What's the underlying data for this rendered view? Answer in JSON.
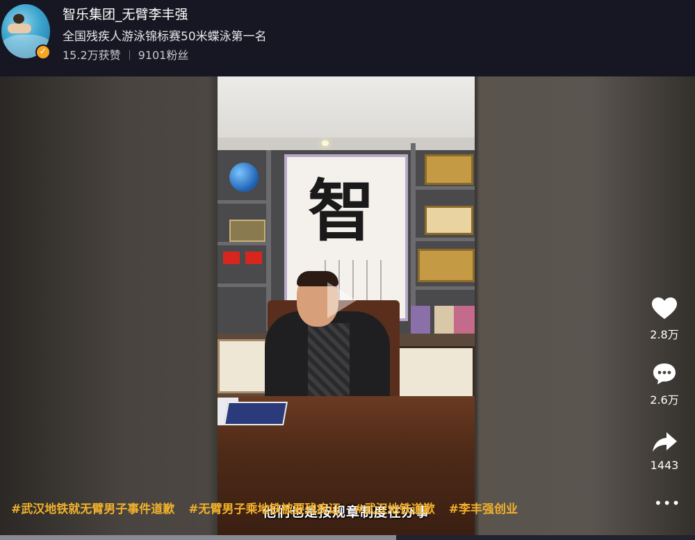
{
  "profile": {
    "name": "智乐集团_无臂李丰强",
    "bio": "全国残疾人游泳锦标赛50米蝶泳第一名",
    "likes": "15.2万获赞",
    "followers": "9101粉丝",
    "verified_icon": "check-icon",
    "verified_color": "#f5a623"
  },
  "video": {
    "calligraphy_char": "智",
    "subtitle": "他们也是按规章制度在办事",
    "progress": 0.57
  },
  "actions": {
    "like": {
      "icon": "heart-icon",
      "count": "2.8万"
    },
    "comment": {
      "icon": "comment-icon",
      "count": "2.6万"
    },
    "share": {
      "icon": "share-icon",
      "count": "1443"
    },
    "more": {
      "icon": "more-icon",
      "label": "•••"
    }
  },
  "hashtags": [
    "#武汉地铁就无臂男子事件道歉",
    "#无臂男子乘地铁被要残疾证",
    "#武汉地铁道歉",
    "#李丰强创业"
  ],
  "colors": {
    "header_bg": "#161722",
    "hashtag": "#f2b12b"
  }
}
